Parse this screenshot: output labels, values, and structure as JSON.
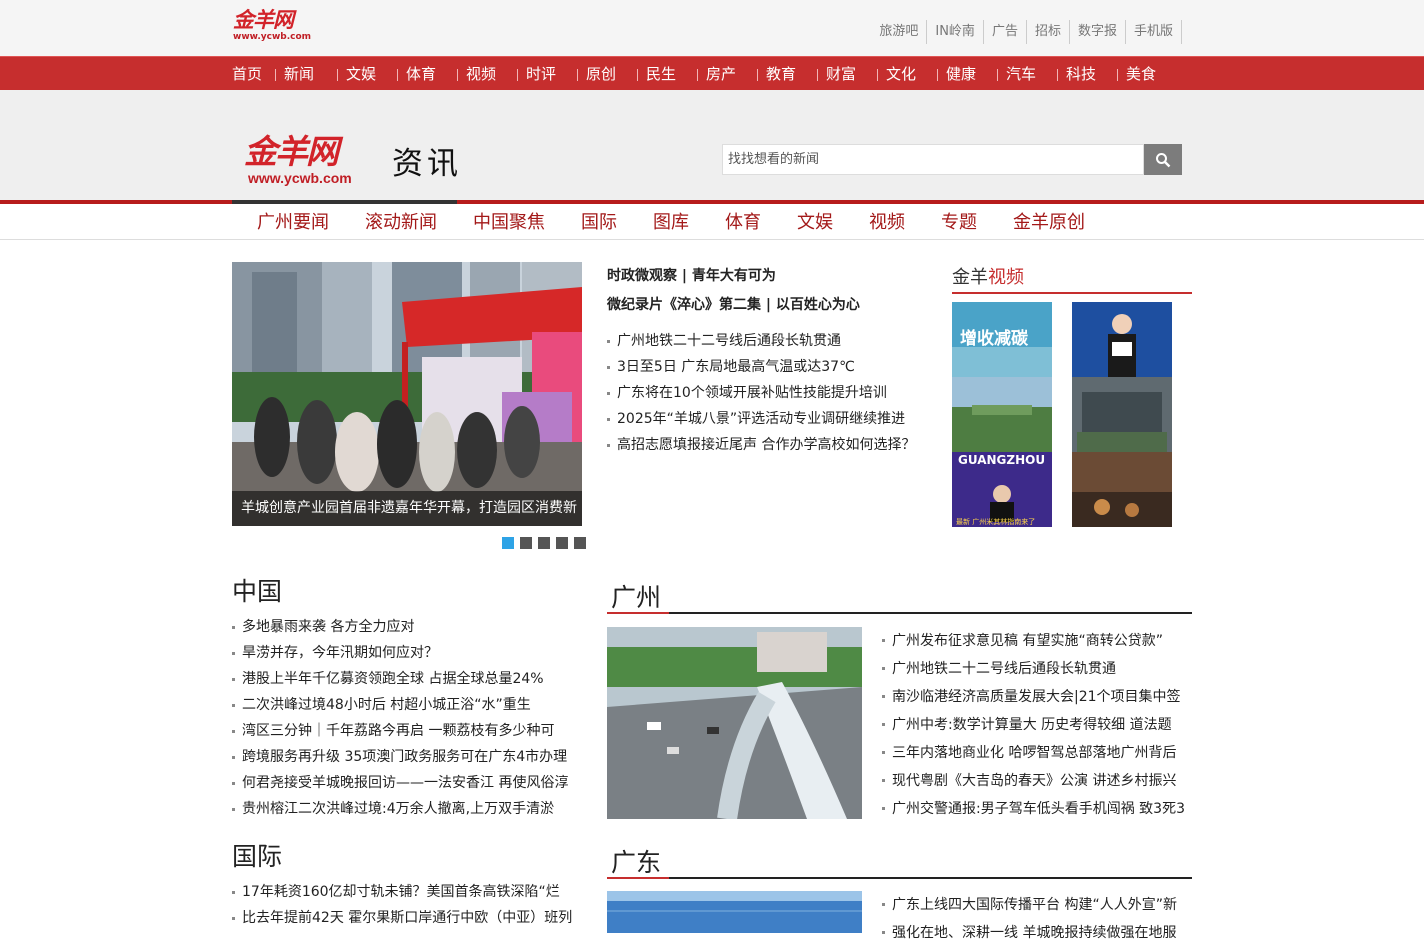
{
  "top": {
    "logo_text": "金羊网",
    "logo_url": "www.ycwb.com",
    "links": [
      "旅游吧",
      "IN岭南",
      "广告",
      "招标",
      "数字报",
      "手机版"
    ]
  },
  "rednav": [
    "首页",
    "新闻",
    "文娱",
    "体育",
    "视频",
    "时评",
    "原创",
    "民生",
    "房产",
    "教育",
    "财富",
    "文化",
    "健康",
    "汽车",
    "科技",
    "美食"
  ],
  "header": {
    "logo_text": "金羊网",
    "logo_url": "www.ycwb.com",
    "channel": "资讯",
    "search_placeholder": "找找想看的新闻"
  },
  "subnav": [
    "广州要闻",
    "滚动新闻",
    "中国聚焦",
    "国际",
    "图库",
    "体育",
    "文娱",
    "视频",
    "专题",
    "金羊原创"
  ],
  "slider": {
    "caption": "羊城创意产业园首届非遗嘉年华开幕，打造园区消费新",
    "dot_count": 5,
    "active_dot": 0
  },
  "headlines": {
    "top1": "时政微观察 | 青年大有可为",
    "top2": "微纪录片《淬心》第二集 | 以百姓心为心",
    "items": [
      "广州地铁二十二号线后通段长轨贯通",
      "3日至5日 广东局地最高气温或达37℃",
      "广东将在10个领域开展补贴性技能提升培训",
      "2025年“羊城八景”评选活动专业调研继续推进",
      "高招志愿填报接近尾声 合作办学高校如何选择？"
    ]
  },
  "video": {
    "title_a": "金羊",
    "title_b": "视频",
    "thumb1_text": "增收减碳",
    "thumb3_text": "GUANGZHOU",
    "thumb3_sub": "最新 广州米其林指南来了"
  },
  "china": {
    "title": "中国",
    "items": [
      "多地暴雨来袭 各方全力应对",
      "旱涝并存，今年汛期如何应对？",
      "港股上半年千亿募资领跑全球 占据全球总量24%",
      "二次洪峰过境48小时后 村超小城正浴“水”重生",
      "湾区三分钟｜千年荔路今再启 一颗荔枝有多少种可",
      "跨境服务再升级 35项澳门政务服务可在广东4市办理",
      "何君尧接受羊城晚报回访——一法安香江 再使风俗淳",
      "贵州榕江二次洪峰过境:4万余人撤离,上万双手清淤"
    ]
  },
  "intl": {
    "title": "国际",
    "items": [
      "17年耗资160亿却寸轨未铺？美国首条高铁深陷“烂",
      "比去年提前42天 霍尔果斯口岸通行中欧（中亚）班列"
    ]
  },
  "guangzhou": {
    "title": "广州",
    "items": [
      "广州发布征求意见稿 有望实施“商转公贷款”",
      "广州地铁二十二号线后通段长轨贯通",
      "南沙临港经济高质量发展大会|21个项目集中签",
      "广州中考:数学计算量大 历史考得较细 道法题",
      "三年内落地商业化 哈啰智驾总部落地广州背后",
      "现代粤剧《大吉岛的春天》公演 讲述乡村振兴",
      "广州交警通报:男子驾车低头看手机闯祸 致3死3"
    ]
  },
  "guangdong": {
    "title": "广东",
    "items": [
      "广东上线四大国际传播平台 构建“人人外宣”新",
      "强化在地、深耕一线 羊城晚报持续做强在地服"
    ]
  },
  "colors": {
    "brand_red": "#c62e2e",
    "subnav_text": "#a31919",
    "dot_active": "#2ea3e6"
  }
}
